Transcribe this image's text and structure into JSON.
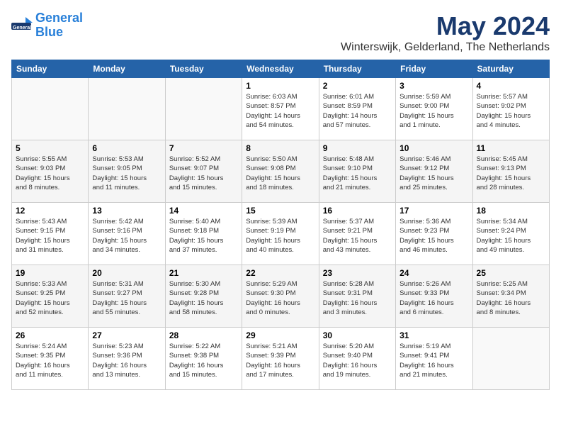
{
  "header": {
    "logo_line1": "General",
    "logo_line2": "Blue",
    "month": "May 2024",
    "location": "Winterswijk, Gelderland, The Netherlands"
  },
  "weekdays": [
    "Sunday",
    "Monday",
    "Tuesday",
    "Wednesday",
    "Thursday",
    "Friday",
    "Saturday"
  ],
  "weeks": [
    [
      {
        "day": "",
        "info": ""
      },
      {
        "day": "",
        "info": ""
      },
      {
        "day": "",
        "info": ""
      },
      {
        "day": "1",
        "info": "Sunrise: 6:03 AM\nSunset: 8:57 PM\nDaylight: 14 hours\nand 54 minutes."
      },
      {
        "day": "2",
        "info": "Sunrise: 6:01 AM\nSunset: 8:59 PM\nDaylight: 14 hours\nand 57 minutes."
      },
      {
        "day": "3",
        "info": "Sunrise: 5:59 AM\nSunset: 9:00 PM\nDaylight: 15 hours\nand 1 minute."
      },
      {
        "day": "4",
        "info": "Sunrise: 5:57 AM\nSunset: 9:02 PM\nDaylight: 15 hours\nand 4 minutes."
      }
    ],
    [
      {
        "day": "5",
        "info": "Sunrise: 5:55 AM\nSunset: 9:03 PM\nDaylight: 15 hours\nand 8 minutes."
      },
      {
        "day": "6",
        "info": "Sunrise: 5:53 AM\nSunset: 9:05 PM\nDaylight: 15 hours\nand 11 minutes."
      },
      {
        "day": "7",
        "info": "Sunrise: 5:52 AM\nSunset: 9:07 PM\nDaylight: 15 hours\nand 15 minutes."
      },
      {
        "day": "8",
        "info": "Sunrise: 5:50 AM\nSunset: 9:08 PM\nDaylight: 15 hours\nand 18 minutes."
      },
      {
        "day": "9",
        "info": "Sunrise: 5:48 AM\nSunset: 9:10 PM\nDaylight: 15 hours\nand 21 minutes."
      },
      {
        "day": "10",
        "info": "Sunrise: 5:46 AM\nSunset: 9:12 PM\nDaylight: 15 hours\nand 25 minutes."
      },
      {
        "day": "11",
        "info": "Sunrise: 5:45 AM\nSunset: 9:13 PM\nDaylight: 15 hours\nand 28 minutes."
      }
    ],
    [
      {
        "day": "12",
        "info": "Sunrise: 5:43 AM\nSunset: 9:15 PM\nDaylight: 15 hours\nand 31 minutes."
      },
      {
        "day": "13",
        "info": "Sunrise: 5:42 AM\nSunset: 9:16 PM\nDaylight: 15 hours\nand 34 minutes."
      },
      {
        "day": "14",
        "info": "Sunrise: 5:40 AM\nSunset: 9:18 PM\nDaylight: 15 hours\nand 37 minutes."
      },
      {
        "day": "15",
        "info": "Sunrise: 5:39 AM\nSunset: 9:19 PM\nDaylight: 15 hours\nand 40 minutes."
      },
      {
        "day": "16",
        "info": "Sunrise: 5:37 AM\nSunset: 9:21 PM\nDaylight: 15 hours\nand 43 minutes."
      },
      {
        "day": "17",
        "info": "Sunrise: 5:36 AM\nSunset: 9:23 PM\nDaylight: 15 hours\nand 46 minutes."
      },
      {
        "day": "18",
        "info": "Sunrise: 5:34 AM\nSunset: 9:24 PM\nDaylight: 15 hours\nand 49 minutes."
      }
    ],
    [
      {
        "day": "19",
        "info": "Sunrise: 5:33 AM\nSunset: 9:25 PM\nDaylight: 15 hours\nand 52 minutes."
      },
      {
        "day": "20",
        "info": "Sunrise: 5:31 AM\nSunset: 9:27 PM\nDaylight: 15 hours\nand 55 minutes."
      },
      {
        "day": "21",
        "info": "Sunrise: 5:30 AM\nSunset: 9:28 PM\nDaylight: 15 hours\nand 58 minutes."
      },
      {
        "day": "22",
        "info": "Sunrise: 5:29 AM\nSunset: 9:30 PM\nDaylight: 16 hours\nand 0 minutes."
      },
      {
        "day": "23",
        "info": "Sunrise: 5:28 AM\nSunset: 9:31 PM\nDaylight: 16 hours\nand 3 minutes."
      },
      {
        "day": "24",
        "info": "Sunrise: 5:26 AM\nSunset: 9:33 PM\nDaylight: 16 hours\nand 6 minutes."
      },
      {
        "day": "25",
        "info": "Sunrise: 5:25 AM\nSunset: 9:34 PM\nDaylight: 16 hours\nand 8 minutes."
      }
    ],
    [
      {
        "day": "26",
        "info": "Sunrise: 5:24 AM\nSunset: 9:35 PM\nDaylight: 16 hours\nand 11 minutes."
      },
      {
        "day": "27",
        "info": "Sunrise: 5:23 AM\nSunset: 9:36 PM\nDaylight: 16 hours\nand 13 minutes."
      },
      {
        "day": "28",
        "info": "Sunrise: 5:22 AM\nSunset: 9:38 PM\nDaylight: 16 hours\nand 15 minutes."
      },
      {
        "day": "29",
        "info": "Sunrise: 5:21 AM\nSunset: 9:39 PM\nDaylight: 16 hours\nand 17 minutes."
      },
      {
        "day": "30",
        "info": "Sunrise: 5:20 AM\nSunset: 9:40 PM\nDaylight: 16 hours\nand 19 minutes."
      },
      {
        "day": "31",
        "info": "Sunrise: 5:19 AM\nSunset: 9:41 PM\nDaylight: 16 hours\nand 21 minutes."
      },
      {
        "day": "",
        "info": ""
      }
    ]
  ]
}
